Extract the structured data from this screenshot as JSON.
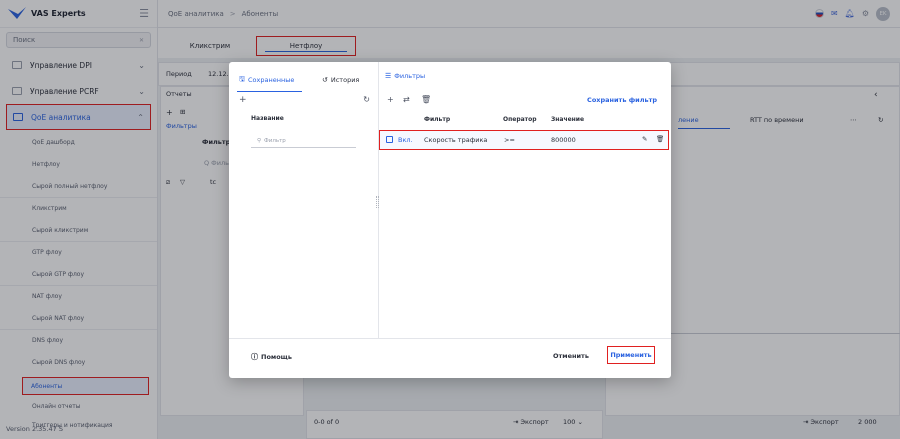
{
  "app": {
    "logo_text": "VAS Experts",
    "version": "Version 2.35.47 S"
  },
  "sidebar": {
    "search_placeholder": "Поиск",
    "groups": [
      {
        "label": "Управление DPI"
      },
      {
        "label": "Управление PCRF"
      },
      {
        "label": "QoE аналитика"
      }
    ],
    "items": [
      "QoE дашборд",
      "Нетфлоу",
      "Сырой полный нетфлоу",
      "Кликстрим",
      "Сырой кликстрим",
      "GTP флоу",
      "Сырой GTP флоу",
      "NAT флоу",
      "Сырой NAT флоу",
      "DNS флоу",
      "Сырой DNS флоу",
      "Абоненты",
      "Онлайн отчеты",
      "Триггеры и нотификация"
    ]
  },
  "breadcrumb": {
    "part1": "QoE аналитика",
    "sep": ">",
    "part2": "Абоненты"
  },
  "user": {
    "initials": "EK"
  },
  "page_tabs": {
    "tab1": "Кликстрим",
    "tab2": "Нетфлоу"
  },
  "background": {
    "period_label": "Период",
    "period_value": "12.12.2",
    "reports_label": "Отчеты",
    "filters_label": "Фильтры",
    "filter_col": "Фильтр",
    "filter_search": "Q Фильт",
    "row_text": "tc",
    "tab_rtt": "RTT по времени",
    "tab_partial": "ление",
    "paging": "0-0 of 0",
    "export": "Экспорт",
    "per_page": "100",
    "export2": "Экспорт",
    "count": "2 000"
  },
  "modal": {
    "tab_saved": "Сохраненные",
    "tab_history": "История",
    "name_header": "Название",
    "name_filter_placeholder": "Фильтр",
    "filters_title": "Фильтры",
    "save_filter": "Сохранить фильтр",
    "columns": {
      "filter": "Фильтр",
      "operator": "Оператор",
      "value": "Значение"
    },
    "row": {
      "enabled": "Вкл.",
      "filter": "Скорость трафика",
      "operator": ">=",
      "value": "800000"
    },
    "help": "Помощь",
    "cancel": "Отменить",
    "apply": "Применить"
  },
  "colors": {
    "accent": "#2a62e0",
    "highlight": "#e02020"
  }
}
